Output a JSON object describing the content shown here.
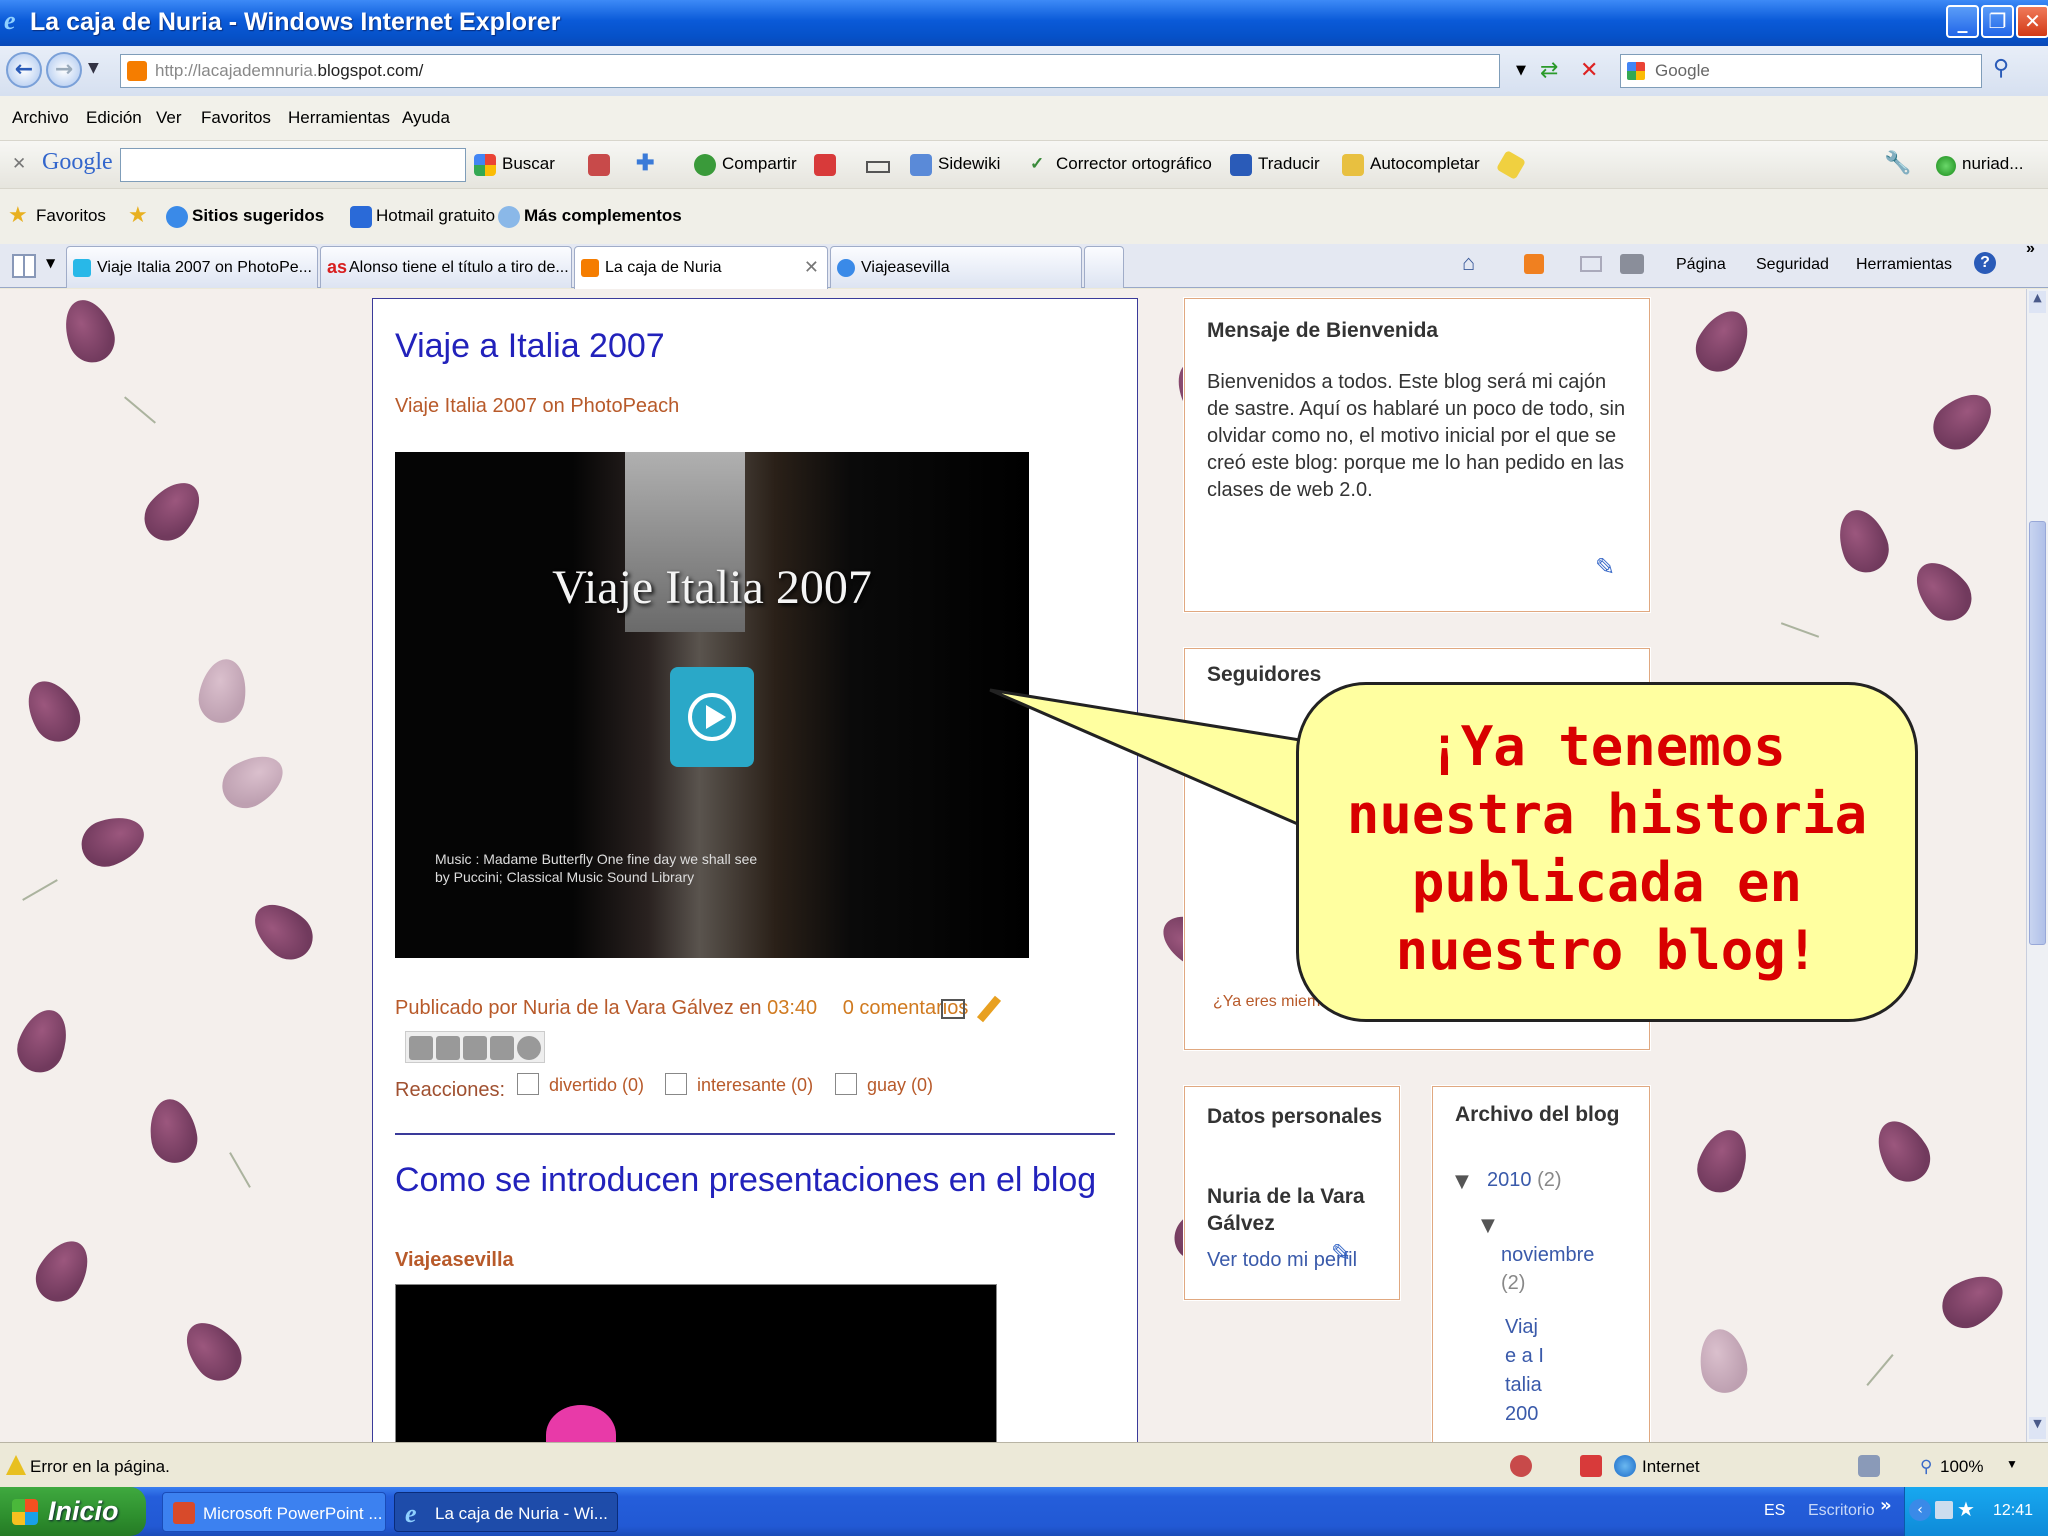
{
  "window": {
    "title": "La caja de Nuria - Windows Internet Explorer"
  },
  "address": {
    "url_prefix": "http://lacajademnuria.",
    "url_domain": "blogspot.com/",
    "search_placeholder": "Google"
  },
  "menu": [
    "Archivo",
    "Edición",
    "Ver",
    "Favoritos",
    "Herramientas",
    "Ayuda"
  ],
  "google_toolbar": {
    "logo": "Google",
    "items": [
      "Buscar",
      "Compartir",
      "Sidewiki",
      "Corrector ortográfico",
      "Traducir",
      "Autocompletar",
      "nuriad..."
    ]
  },
  "favorites_bar": {
    "favorites": "Favoritos",
    "suggested": "Sitios sugeridos",
    "hotmail": "Hotmail gratuito",
    "more": "Más complementos"
  },
  "tabs": [
    {
      "label": "Viaje Italia 2007 on PhotoPe...",
      "active": false
    },
    {
      "label": "Alonso tiene el título a tiro de...",
      "active": false
    },
    {
      "label": "La caja de Nuria",
      "active": true
    },
    {
      "label": "Viajeasevilla",
      "active": false
    }
  ],
  "command_bar": [
    "Página",
    "Seguridad",
    "Herramientas"
  ],
  "post1": {
    "title": "Viaje a Italia 2007",
    "embed_link": "Viaje Italia 2007 on PhotoPeach",
    "video_title": "Viaje Italia 2007",
    "video_credit_1": "Music : Madame Butterfly One fine day we shall see",
    "video_credit_2": "by Puccini; Classical Music Sound Library",
    "published_by": "Publicado por Nuria de la Vara Gálvez en",
    "time": "03:40",
    "comments": "0 comentarios",
    "reactions_label": "Reacciones:",
    "reactions": [
      "divertido (0)",
      "interesante (0)",
      "guay (0)"
    ]
  },
  "post2": {
    "title": "Como se introducen presentaciones en el blog",
    "embed_link": "Viajeasevilla"
  },
  "welcome": {
    "title": "Mensaje de Bienvenida",
    "text": "Bienvenidos a todos. Este blog será mi cajón de sastre. Aquí os hablaré un poco de todo, sin olvidar como no, el motivo inicial por el que se creó este blog: porque me lo han pedido en las clases de web 2.0."
  },
  "followers": {
    "title": "Seguidores",
    "member_link": "¿Ya eres miem"
  },
  "profile": {
    "title": "Datos personales",
    "name": "Nuria de la Vara Gálvez",
    "link": "Ver todo mi perfil"
  },
  "archive": {
    "title": "Archivo del blog",
    "year": "2010",
    "year_count": "(2)",
    "month": "noviembre",
    "month_count": "(2)",
    "post": "Viaje a Italia 200"
  },
  "bubble": {
    "line1": "¡Ya tenemos",
    "line2": "nuestra historia",
    "line3": "publicada en",
    "line4": "nuestro blog!"
  },
  "statusbar": {
    "error": "Error en la página.",
    "zone": "Internet",
    "zoom": "100%"
  },
  "taskbar": {
    "start": "Inicio",
    "items": [
      "Microsoft PowerPoint ...",
      "La caja de Nuria - Wi..."
    ],
    "lang": "ES",
    "desktop": "Escritorio",
    "clock": "12:41"
  },
  "colors": {
    "title_bar": "#0a5ad8",
    "post_title": "#2222bb",
    "link_brown": "#b85a2a",
    "bubble_fill": "#ffffa0",
    "bubble_text": "#d80000"
  }
}
